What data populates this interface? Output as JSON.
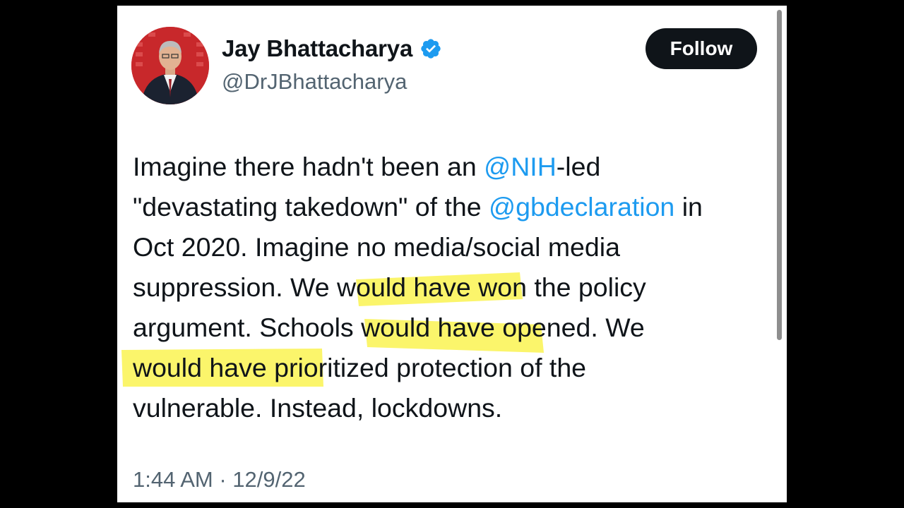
{
  "tweet": {
    "author": {
      "display_name": "Jay Bhattacharya",
      "handle": "@DrJBhattacharya",
      "verified": true,
      "verified_icon": "verified-badge-icon",
      "verified_color": "#1d9bf0"
    },
    "follow_label": "Follow",
    "text_lines": [
      [
        {
          "t": "Imagine there hadn't been an "
        },
        {
          "t": "@NIH",
          "m": true
        },
        {
          "t": "-led"
        }
      ],
      [
        {
          "t": "\"devastating takedown\" of the "
        },
        {
          "t": "@gbdeclaration",
          "m": true
        },
        {
          "t": " in"
        }
      ],
      [
        {
          "t": "Oct 2020. Imagine no media/social media"
        }
      ],
      [
        {
          "t": "suppression. We would have won the policy"
        }
      ],
      [
        {
          "t": "argument. Schools would have opened. We"
        }
      ],
      [
        {
          "t": "would have prioritized protection of the"
        }
      ],
      [
        {
          "t": "vulnerable. Instead, lockdowns."
        }
      ]
    ],
    "timestamp": "1:44 AM · 12/9/22"
  },
  "colors": {
    "text": "#0f1419",
    "secondary": "#536471",
    "mention": "#1d9bf0",
    "highlighter": "#fbf463",
    "follow_bg": "#0f1419"
  }
}
